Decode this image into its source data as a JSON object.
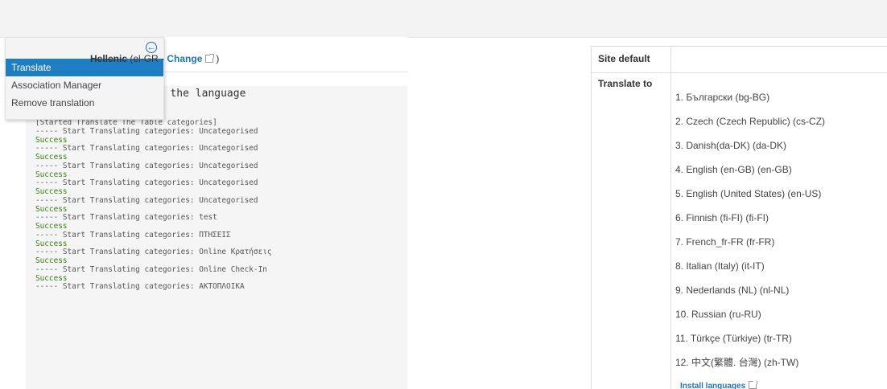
{
  "menu": {
    "items": [
      {
        "label": "Translate",
        "active": true
      },
      {
        "label": "Association Manager",
        "active": false
      },
      {
        "label": "Remove translation",
        "active": false
      }
    ],
    "collapse_icon": "circle-arrow-left-icon"
  },
  "log": {
    "heading": "or the language",
    "lines": [
      {
        "text": "[Started Translate The Table categories]",
        "type": "info"
      },
      {
        "text": "----- Start Translating categories: Uncategorised",
        "type": "info"
      },
      {
        "text": "Success",
        "type": "ok"
      },
      {
        "text": "----- Start Translating categories: Uncategorised",
        "type": "info"
      },
      {
        "text": "Success",
        "type": "ok"
      },
      {
        "text": "----- Start Translating categories: Uncategorised",
        "type": "info"
      },
      {
        "text": "Success",
        "type": "ok"
      },
      {
        "text": "----- Start Translating categories: Uncategorised",
        "type": "info"
      },
      {
        "text": "Success",
        "type": "ok"
      },
      {
        "text": "----- Start Translating categories: Uncategorised",
        "type": "info"
      },
      {
        "text": "Success",
        "type": "ok"
      },
      {
        "text": "----- Start Translating categories: test",
        "type": "info"
      },
      {
        "text": "Success",
        "type": "ok"
      },
      {
        "text": "----- Start Translating categories: ΠΤΗΣΕΙΣ",
        "type": "info"
      },
      {
        "text": "Success",
        "type": "ok"
      },
      {
        "text": "----- Start Translating categories: Online Κρατήσεις",
        "type": "info"
      },
      {
        "text": "Success",
        "type": "ok"
      },
      {
        "text": "----- Start Translating categories: Online Check-In",
        "type": "info"
      },
      {
        "text": "Success",
        "type": "ok"
      },
      {
        "text": "----- Start Translating categories: ΑΚΤΟΠΛΟΙΚΑ",
        "type": "info"
      }
    ]
  },
  "settings": {
    "site_default_label": "Site default",
    "site_default_language": "Hellenic",
    "site_default_code_prefix": "(el-GR - ",
    "change_label": "Change",
    "site_default_suffix": ")",
    "translate_to_label": "Translate to",
    "languages": [
      "1.  Български (bg-BG)",
      "2.  Czech (Czech Republic) (cs-CZ)",
      "3.  Danish(da-DK) (da-DK)",
      "4.  English (en-GB) (en-GB)",
      "5.  English (United States) (en-US)",
      "6.  Finnish (fi-FI) (fi-FI)",
      "7.  French_fr-FR (fr-FR)",
      "8.  Italian (Italy) (it-IT)",
      "9.  Nederlands (NL) (nl-NL)",
      "10.  Russian (ru-RU)",
      "11.  Türkçe (Türkiye) (tr-TR)",
      "12.  中文(繁體. 台灣) (zh-TW)"
    ],
    "install_languages_label": "Install languages"
  }
}
